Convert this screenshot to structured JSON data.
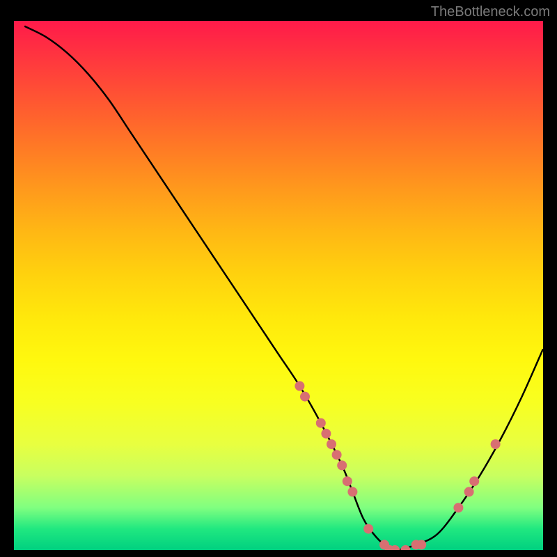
{
  "watermark": "TheBottleneck.com",
  "chart_data": {
    "type": "line",
    "title": "",
    "xlabel": "",
    "ylabel": "",
    "xlim": [
      0,
      100
    ],
    "ylim": [
      0,
      100
    ],
    "curve": {
      "x": [
        2,
        6,
        10,
        14,
        18,
        22,
        26,
        30,
        34,
        38,
        42,
        46,
        50,
        54,
        58,
        62,
        64,
        66,
        68,
        70,
        72,
        76,
        80,
        84,
        88,
        92,
        96,
        100
      ],
      "y": [
        99,
        97,
        94,
        90,
        85,
        79,
        73,
        67,
        61,
        55,
        49,
        43,
        37,
        31,
        24,
        16,
        11,
        6,
        3,
        1,
        0,
        1,
        3,
        8,
        14,
        21,
        29,
        38
      ]
    },
    "markers": {
      "x": [
        54,
        55,
        58,
        59,
        60,
        61,
        62,
        63,
        64,
        67,
        70,
        71,
        72,
        74,
        76,
        77,
        84,
        86,
        87,
        91
      ],
      "y": [
        31,
        29,
        24,
        22,
        20,
        18,
        16,
        13,
        11,
        4,
        1,
        0,
        0,
        0,
        1,
        1,
        8,
        11,
        13,
        20
      ],
      "color": "#d86f72"
    },
    "gradient_colors": {
      "top": "#ff1a4a",
      "mid_upper": "#ff9a1c",
      "mid": "#ffe80c",
      "mid_lower": "#e8ff40",
      "bottom": "#00d080"
    }
  }
}
